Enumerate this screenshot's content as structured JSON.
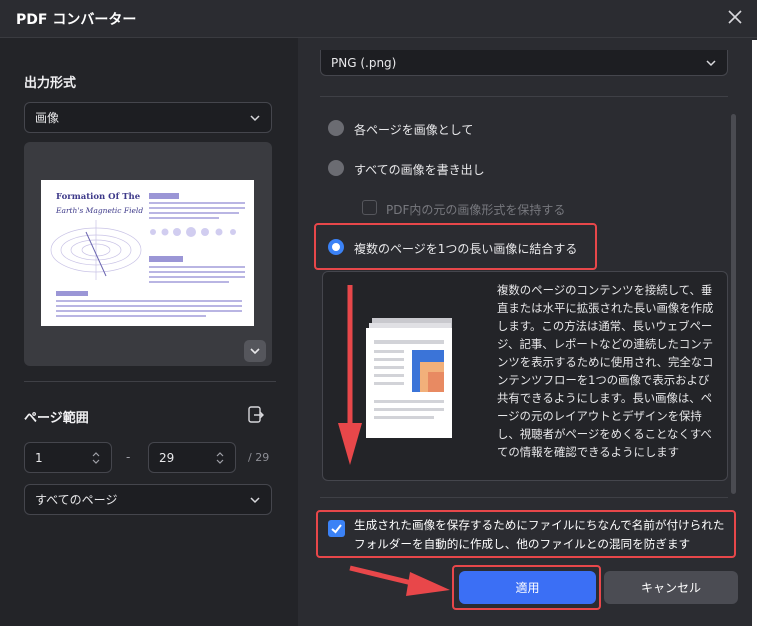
{
  "window": {
    "title": "PDF コンバーター"
  },
  "left": {
    "output_format_label": "出力形式",
    "output_format_value": "画像",
    "preview": {
      "doc_title_line1": "Formation Of The",
      "doc_title_line2": "Earth's Magnetic Field"
    },
    "page_range_label": "ページ範囲",
    "range_from": "1",
    "range_dash": "-",
    "range_to": "29",
    "range_total": "/ 29",
    "pages_select": "すべてのページ"
  },
  "right": {
    "format_select": "PNG (.png)",
    "options": [
      {
        "label": "各ページを画像として",
        "selected": false
      },
      {
        "label": "すべての画像を書き出し",
        "selected": false
      },
      {
        "label": "PDF内の元の画像形式を保持する",
        "selected": false,
        "disabled": true
      },
      {
        "label": "複数のページを1つの長い画像に結合する",
        "selected": true
      }
    ],
    "description": "複数のページのコンテンツを接続して、垂直または水平に拡張された長い画像を作成します。この方法は通常、長いウェブページ、記事、レポートなどの連続したコンテンツを表示するために使用され、完全なコンテンツフローを1つの画像で表示および共有できるようにします。長い画像は、ページの元のレイアウトとデザインを保持し、視聴者がページをめくることなくすべての情報を確認できるようにします",
    "checkbox_label": "生成された画像を保存するためにファイルにちなんで名前が付けられたフォルダーを自動的に作成し、他のファイルとの混同を防ぎます"
  },
  "buttons": {
    "apply": "適用",
    "cancel": "キャンセル"
  },
  "colors": {
    "accent": "#3b6ff5",
    "highlight": "#e8474a"
  }
}
